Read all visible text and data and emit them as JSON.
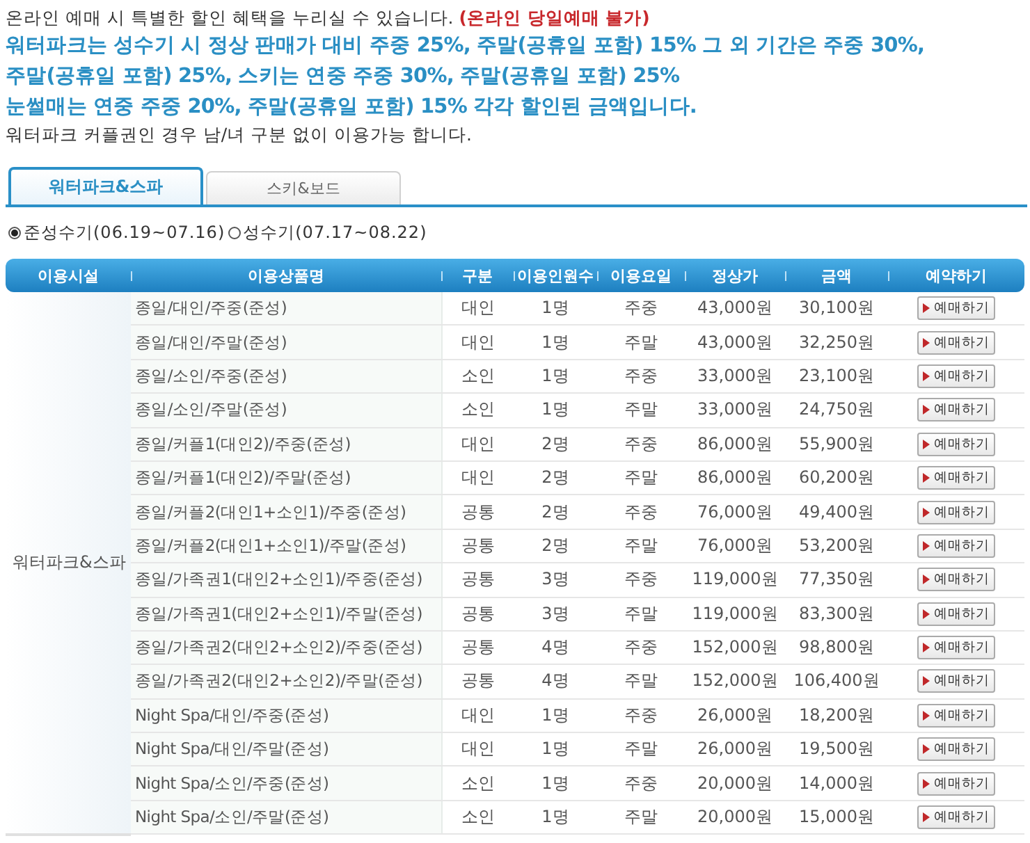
{
  "intro": {
    "text": "온라인 예매 시 특별한 할인 혜택을 누리실 수 있습니다.",
    "note": "(온라인 당일예매 불가)"
  },
  "discount_lines": [
    "워터파크는 성수기 시  정상 판매가 대비 주중 25%, 주말(공휴일 포함) 15% 그 외 기간은 주중 30%,",
    "주말(공휴일 포함) 25%, 스키는 연중 주중 30%, 주말(공휴일 포함) 25%",
    "눈썰매는 연중 주중 20%, 주말(공휴일 포함) 15% 각각 할인된 금액입니다."
  ],
  "couple_note": "워터파크 커플권인 경우 남/녀 구분 없이 이용가능 합니다.",
  "tabs": [
    {
      "label": "워터파크&스파",
      "selected": true
    },
    {
      "label": "스키&보드",
      "selected": false
    }
  ],
  "seasons": [
    {
      "label": "준성수기(06.19~07.16)",
      "selected": true
    },
    {
      "label": "성수기(07.17~08.22)",
      "selected": false
    }
  ],
  "table": {
    "columns": [
      "이용시설",
      "이용상품명",
      "구분",
      "이용인원수",
      "이용요일",
      "정상가",
      "금액",
      "예약하기"
    ],
    "facility": "워터파크&스파",
    "rows": [
      {
        "name": "종일/대인/주중(준성)",
        "type": "대인",
        "people": "1명",
        "day": "주중",
        "regular": "43,000원",
        "price": "30,100원",
        "button": "예매하기"
      },
      {
        "name": "종일/대인/주말(준성)",
        "type": "대인",
        "people": "1명",
        "day": "주말",
        "regular": "43,000원",
        "price": "32,250원",
        "button": "예매하기"
      },
      {
        "name": "종일/소인/주중(준성)",
        "type": "소인",
        "people": "1명",
        "day": "주중",
        "regular": "33,000원",
        "price": "23,100원",
        "button": "예매하기"
      },
      {
        "name": "종일/소인/주말(준성)",
        "type": "소인",
        "people": "1명",
        "day": "주말",
        "regular": "33,000원",
        "price": "24,750원",
        "button": "예매하기"
      },
      {
        "name": "종일/커플1(대인2)/주중(준성)",
        "type": "대인",
        "people": "2명",
        "day": "주중",
        "regular": "86,000원",
        "price": "55,900원",
        "button": "예매하기"
      },
      {
        "name": "종일/커플1(대인2)/주말(준성)",
        "type": "대인",
        "people": "2명",
        "day": "주말",
        "regular": "86,000원",
        "price": "60,200원",
        "button": "예매하기"
      },
      {
        "name": "종일/커플2(대인1+소인1)/주중(준성)",
        "type": "공통",
        "people": "2명",
        "day": "주중",
        "regular": "76,000원",
        "price": "49,400원",
        "button": "예매하기"
      },
      {
        "name": "종일/커플2(대인1+소인1)/주말(준성)",
        "type": "공통",
        "people": "2명",
        "day": "주말",
        "regular": "76,000원",
        "price": "53,200원",
        "button": "예매하기"
      },
      {
        "name": "종일/가족권1(대인2+소인1)/주중(준성)",
        "type": "공통",
        "people": "3명",
        "day": "주중",
        "regular": "119,000원",
        "price": "77,350원",
        "button": "예매하기"
      },
      {
        "name": "종일/가족권1(대인2+소인1)/주말(준성)",
        "type": "공통",
        "people": "3명",
        "day": "주말",
        "regular": "119,000원",
        "price": "83,300원",
        "button": "예매하기"
      },
      {
        "name": "종일/가족권2(대인2+소인2)/주중(준성)",
        "type": "공통",
        "people": "4명",
        "day": "주중",
        "regular": "152,000원",
        "price": "98,800원",
        "button": "예매하기"
      },
      {
        "name": "종일/가족권2(대인2+소인2)/주말(준성)",
        "type": "공통",
        "people": "4명",
        "day": "주말",
        "regular": "152,000원",
        "price": "106,400원",
        "button": "예매하기"
      },
      {
        "name": "Night Spa/대인/주중(준성)",
        "type": "대인",
        "people": "1명",
        "day": "주중",
        "regular": "26,000원",
        "price": "18,200원",
        "button": "예매하기"
      },
      {
        "name": "Night Spa/대인/주말(준성)",
        "type": "대인",
        "people": "1명",
        "day": "주말",
        "regular": "26,000원",
        "price": "19,500원",
        "button": "예매하기"
      },
      {
        "name": "Night Spa/소인/주중(준성)",
        "type": "소인",
        "people": "1명",
        "day": "주중",
        "regular": "20,000원",
        "price": "14,000원",
        "button": "예매하기"
      },
      {
        "name": "Night Spa/소인/주말(준성)",
        "type": "소인",
        "people": "1명",
        "day": "주말",
        "regular": "20,000원",
        "price": "15,000원",
        "button": "예매하기"
      }
    ]
  }
}
